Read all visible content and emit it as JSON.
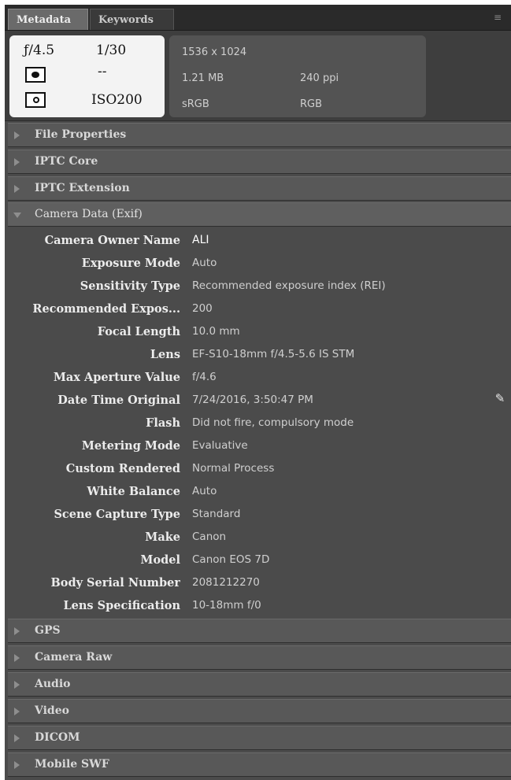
{
  "tabs": [
    {
      "label": "Metadata",
      "active": true
    },
    {
      "label": "Keywords",
      "active": false
    }
  ],
  "panel_menu_icon": "flyout-menu-icon",
  "exif_summary": {
    "aperture": "ƒ/4.5",
    "shutter": "1/30",
    "metering_value": "--",
    "iso": "ISO200"
  },
  "file_summary": {
    "dimensions": "1536 x 1024",
    "file_size": "1.21 MB",
    "resolution": "240 ppi",
    "color_profile": "sRGB",
    "color_mode": "RGB"
  },
  "sections_top": [
    "File Properties",
    "IPTC Core",
    "IPTC Extension"
  ],
  "open_section": "Camera Data (Exif)",
  "camera_data": [
    {
      "key": "Camera Owner Name",
      "value": "ALI"
    },
    {
      "key": "Exposure Mode",
      "value": "Auto"
    },
    {
      "key": "Sensitivity Type",
      "value": "Recommended exposure index (REI)"
    },
    {
      "key": "Recommended Expos...",
      "value": "200"
    },
    {
      "key": "Focal Length",
      "value": "10.0 mm"
    },
    {
      "key": "Lens",
      "value": "EF-S10-18mm f/4.5-5.6 IS STM"
    },
    {
      "key": "Max Aperture Value",
      "value": "f/4.6"
    },
    {
      "key": "Date Time Original",
      "value": "7/24/2016, 3:50:47 PM"
    },
    {
      "key": "Flash",
      "value": "Did not fire, compulsory mode"
    },
    {
      "key": "Metering Mode",
      "value": "Evaluative"
    },
    {
      "key": "Custom Rendered",
      "value": "Normal Process"
    },
    {
      "key": "White Balance",
      "value": "Auto"
    },
    {
      "key": "Scene Capture Type",
      "value": "Standard"
    },
    {
      "key": "Make",
      "value": "Canon"
    },
    {
      "key": "Model",
      "value": "Canon EOS 7D"
    },
    {
      "key": "Body Serial Number",
      "value": "2081212270"
    },
    {
      "key": "Lens Specification",
      "value": "10-18mm f/0"
    }
  ],
  "sections_bottom": [
    "GPS",
    "Camera Raw",
    "Audio",
    "Video",
    "DICOM",
    "Mobile SWF"
  ]
}
